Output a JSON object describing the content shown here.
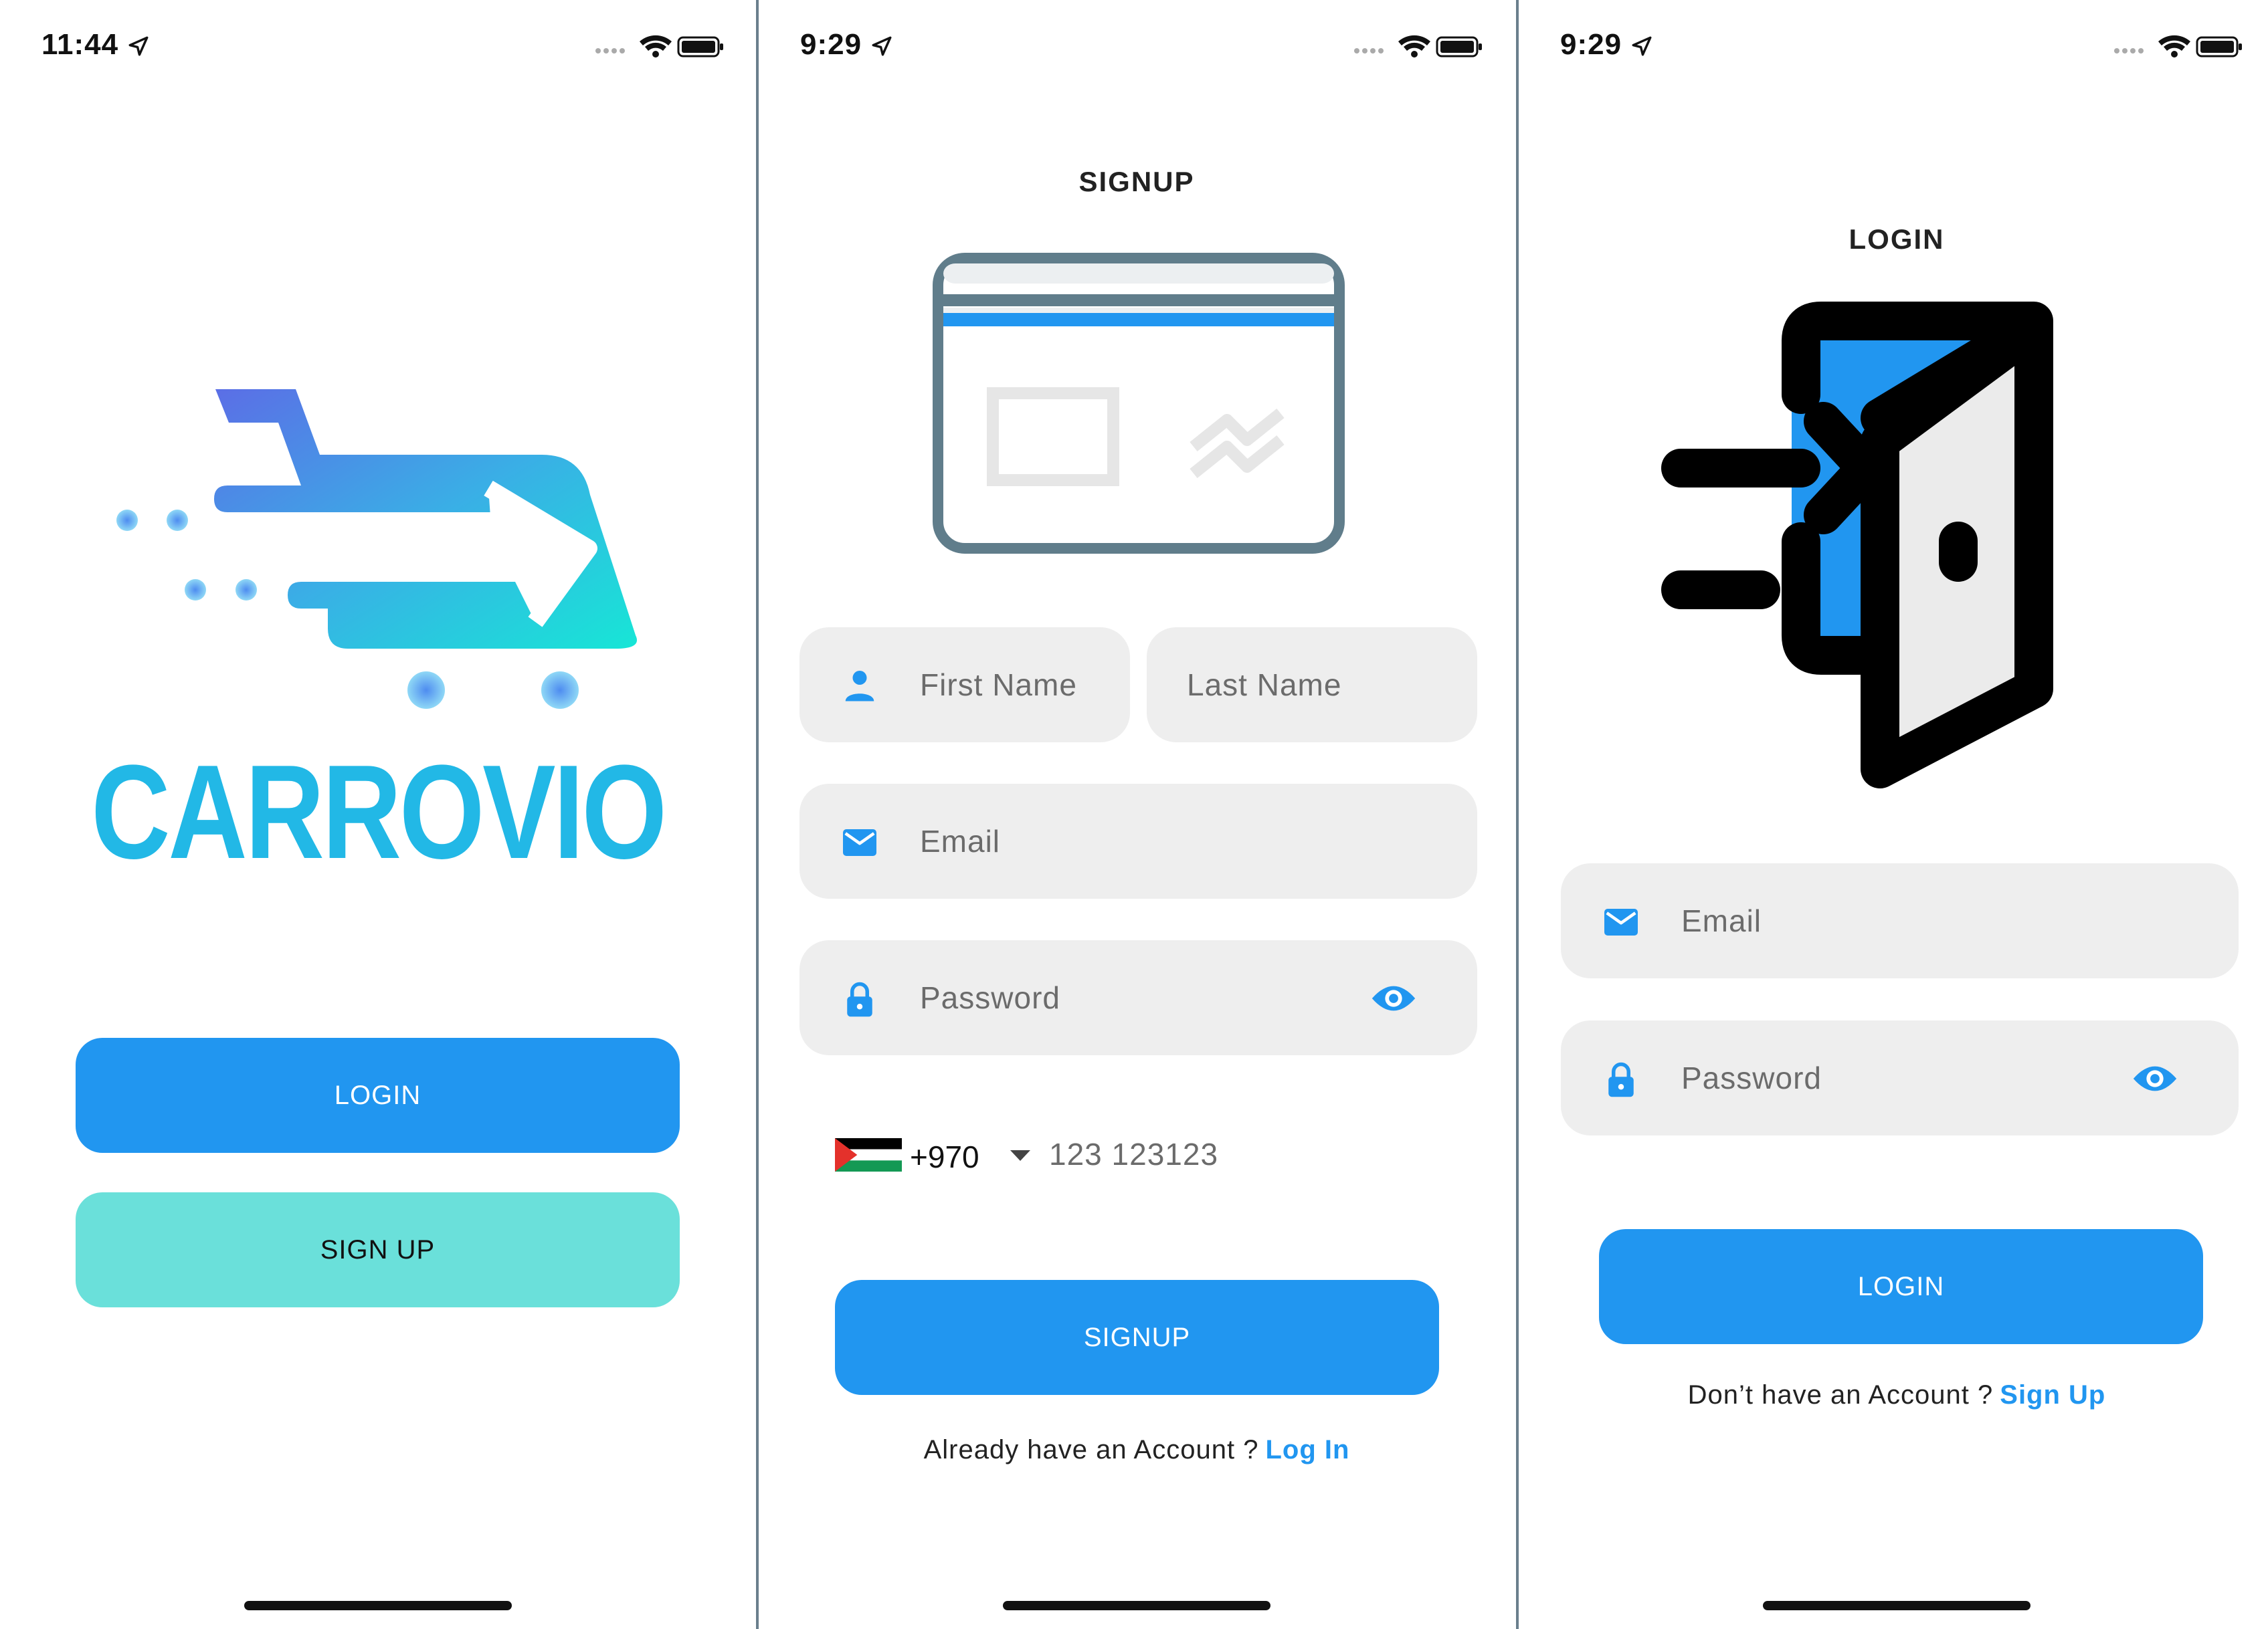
{
  "screens": {
    "welcome": {
      "status_time": "11:44",
      "brand_name": "CARROVIO",
      "login_button": "LOGIN",
      "signup_button": "SIGN UP"
    },
    "signup": {
      "status_time": "9:29",
      "title": "SIGNUP",
      "first_name_placeholder": "First Name",
      "last_name_placeholder": "Last Name",
      "email_placeholder": "Email",
      "password_placeholder": "Password",
      "country_code": "+970",
      "phone_placeholder": "123 123123",
      "signup_button": "SIGNUP",
      "footer_text": "Already have an Account ?",
      "footer_link": "Log In"
    },
    "login": {
      "status_time": "9:29",
      "title": "LOGIN",
      "email_placeholder": "Email",
      "password_placeholder": "Password",
      "login_button": "LOGIN",
      "footer_text": "Don’t have an Account ?",
      "footer_link": "Sign Up"
    }
  },
  "icons": {
    "status_bar": [
      "location-arrow-icon",
      "signal-dots-icon",
      "wifi-icon",
      "battery-icon"
    ],
    "fields": [
      "person-icon",
      "mail-icon",
      "lock-icon",
      "eye-icon"
    ],
    "illustrations": [
      "cart-arrow-logo",
      "credit-card-illustration",
      "door-enter-illustration",
      "palestine-flag-icon",
      "dropdown-caret-icon"
    ]
  },
  "colors": {
    "primary": "#2196f0",
    "secondary": "#6ae0da",
    "field_bg": "#eeeeee",
    "card_outline": "#607d8b",
    "divider": "#6a7f8d"
  }
}
